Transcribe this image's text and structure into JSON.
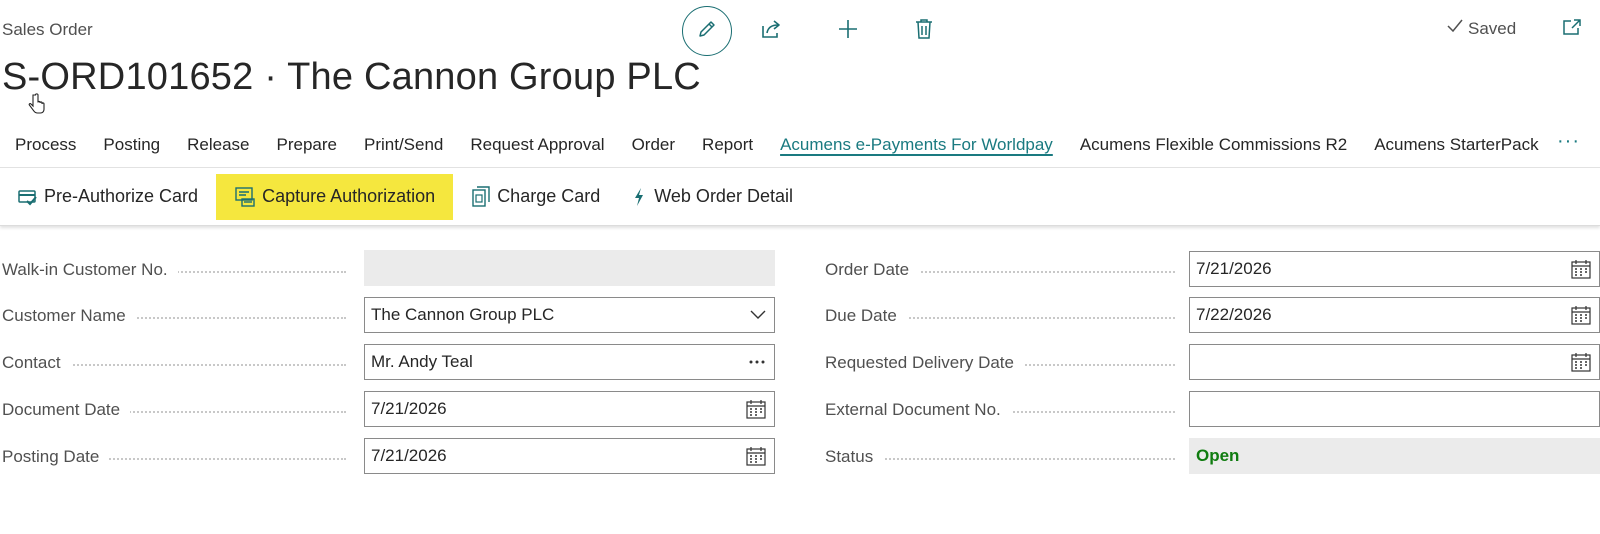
{
  "header": {
    "page_type": "Sales Order",
    "title": "S-ORD101652 · The Cannon Group PLC",
    "saved_label": "Saved"
  },
  "top_actions": [
    "edit-icon",
    "share-icon",
    "new-icon",
    "delete-icon"
  ],
  "nav": {
    "items": [
      {
        "label": "Process"
      },
      {
        "label": "Posting"
      },
      {
        "label": "Release"
      },
      {
        "label": "Prepare"
      },
      {
        "label": "Print/Send"
      },
      {
        "label": "Request Approval"
      },
      {
        "label": "Order"
      },
      {
        "label": "Report"
      },
      {
        "label": "Acumens e-Payments For Worldpay",
        "active": true
      },
      {
        "label": "Acumens Flexible Commissions R2"
      },
      {
        "label": "Acumens StarterPack"
      }
    ],
    "more": "···"
  },
  "actions": [
    {
      "label": "Pre-Authorize Card",
      "icon": "card-check-icon"
    },
    {
      "label": "Capture Authorization",
      "icon": "capture-icon",
      "highlighted": true
    },
    {
      "label": "Charge Card",
      "icon": "charge-card-icon"
    },
    {
      "label": "Web Order Detail",
      "icon": "lightning-icon"
    }
  ],
  "fields_left": [
    {
      "label": "Walk-in Customer No.",
      "value": "",
      "control": "disabled"
    },
    {
      "label": "Customer Name",
      "value": "The Cannon Group PLC",
      "control": "dropdown"
    },
    {
      "label": "Contact",
      "value": "Mr. Andy Teal",
      "control": "lookup"
    },
    {
      "label": "Document Date",
      "value": "7/21/2026",
      "control": "date"
    },
    {
      "label": "Posting Date",
      "value": "7/21/2026",
      "control": "date"
    }
  ],
  "fields_right": [
    {
      "label": "Order Date",
      "value": "7/21/2026",
      "control": "date"
    },
    {
      "label": "Due Date",
      "value": "7/22/2026",
      "control": "date"
    },
    {
      "label": "Requested Delivery Date",
      "value": "",
      "control": "date"
    },
    {
      "label": "External Document No.",
      "value": "",
      "control": "text"
    },
    {
      "label": "Status",
      "value": "Open",
      "control": "status"
    }
  ],
  "colors": {
    "accent": "#1a7a80",
    "highlight": "#f5e73e",
    "status_open": "#107c10"
  }
}
